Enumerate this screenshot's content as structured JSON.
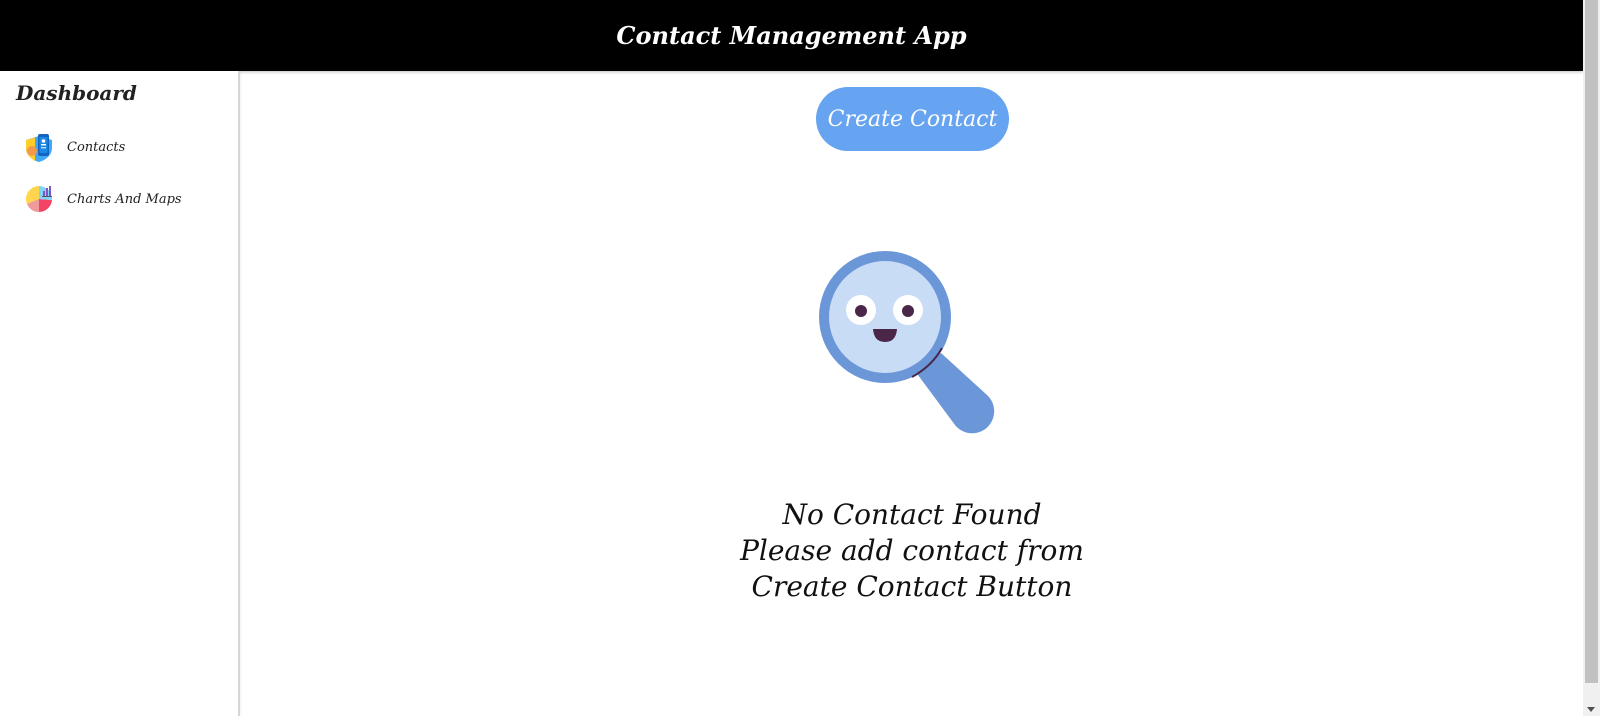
{
  "header": {
    "title": "Contact Management App"
  },
  "sidebar": {
    "title": "Dashboard",
    "items": [
      {
        "label": "Contacts",
        "icon": "contacts-icon"
      },
      {
        "label": "Charts And Maps",
        "icon": "charts-icon"
      }
    ]
  },
  "main": {
    "create_button_label": "Create Contact",
    "empty_state": {
      "icon": "magnifier-face-icon",
      "lines": [
        "No Contact Found",
        "Please add contact from",
        "Create Contact Button"
      ]
    }
  },
  "colors": {
    "header_bg": "#000000",
    "button_bg": "#66a3f0",
    "magnifier_blue": "#6b97d9",
    "lens_fill": "#c9dcf5"
  }
}
